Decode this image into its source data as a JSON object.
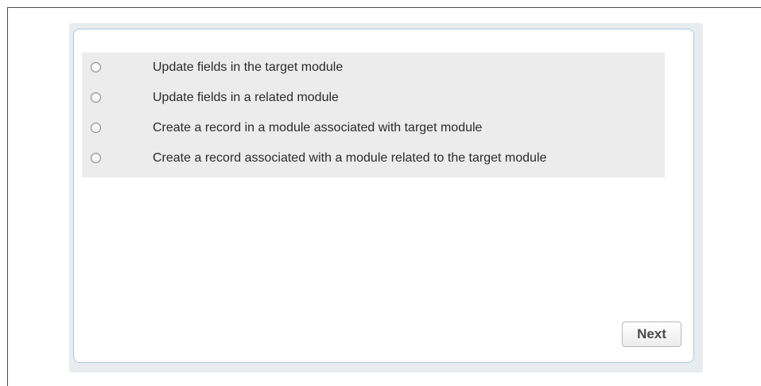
{
  "options": [
    {
      "label": "Update fields in the target module",
      "selected": false
    },
    {
      "label": "Update fields in a related module",
      "selected": false
    },
    {
      "label": "Create a record in a module associated with target module",
      "selected": false
    },
    {
      "label": "Create a record associated with a module related to the target module",
      "selected": false
    }
  ],
  "footer": {
    "next_label": "Next"
  }
}
